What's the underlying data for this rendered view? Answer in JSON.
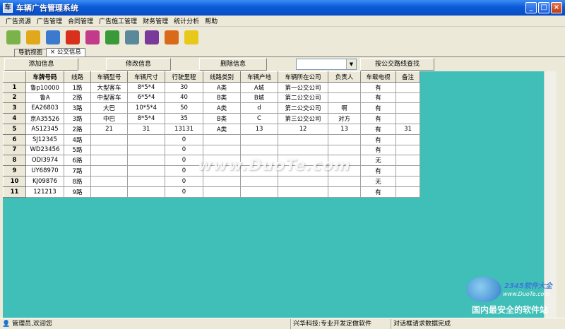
{
  "window": {
    "title": "车辆广告管理系统",
    "icon": "app-icon"
  },
  "menu": [
    "广告资源",
    "广告管理",
    "合同管理",
    "广告施工管理",
    "财务管理",
    "统计分析",
    "帮助"
  ],
  "toolbar": [
    {
      "icon": "people-icon",
      "color": "#7ab34a"
    },
    {
      "icon": "documents-icon",
      "color": "#e0a81a"
    },
    {
      "icon": "forms-icon",
      "color": "#3c7ad0"
    },
    {
      "icon": "umbrella-icon",
      "color": "#d8301c"
    },
    {
      "icon": "alarm-clock-icon",
      "color": "#c43a8a"
    },
    {
      "icon": "picture-icon",
      "color": "#3a9a3a"
    },
    {
      "icon": "pda-icon",
      "color": "#5a8a9a"
    },
    {
      "icon": "help-book-icon",
      "color": "#7a3a9a"
    },
    {
      "icon": "gift-icon",
      "color": "#d86a1a"
    },
    {
      "icon": "running-man-icon",
      "color": "#e8c81a"
    }
  ],
  "tabs": [
    {
      "label": "导航视图",
      "active": false
    },
    {
      "label": "× 公交信息",
      "active": true
    }
  ],
  "actions": {
    "add": "添加信息",
    "edit": "修改信息",
    "delete": "删除信息",
    "query": "按公交路线查找",
    "combo_value": ""
  },
  "table": {
    "columns": [
      "车牌号码",
      "线路",
      "车辆型号",
      "车辆尺寸",
      "行驶里程",
      "线路类别",
      "车辆产地",
      "车辆所在公司",
      "负责人",
      "车载电视",
      "备注"
    ],
    "rows": [
      [
        "1",
        "鲁p10000",
        "1路",
        "大型客车",
        "8*5*4",
        "30",
        "A类",
        "A城",
        "第一公交公司",
        "",
        "有",
        ""
      ],
      [
        "2",
        "鲁A",
        "2路",
        "中型客车",
        "6*5*4",
        "40",
        "B类",
        "B城",
        "第二公交公司",
        "",
        "有",
        ""
      ],
      [
        "3",
        "EA26803",
        "3路",
        "大巴",
        "10*5*4",
        "50",
        "A类",
        "d",
        "第二公交公司",
        "啊",
        "有",
        ""
      ],
      [
        "4",
        "京A35526",
        "3路",
        "中巴",
        "8*5*4",
        "35",
        "B类",
        "C",
        "第三公交公司",
        "对方",
        "有",
        ""
      ],
      [
        "5",
        "AS12345",
        "2路",
        "21",
        "31",
        "13131",
        "A类",
        "13",
        "12",
        "13",
        "有",
        "31"
      ],
      [
        "6",
        "SJ12345",
        "4路",
        "",
        "",
        "0",
        "",
        "",
        "",
        "",
        "有",
        ""
      ],
      [
        "7",
        "WD23456",
        "5路",
        "",
        "",
        "0",
        "",
        "",
        "",
        "",
        "有",
        ""
      ],
      [
        "8",
        "ODI3974",
        "6路",
        "",
        "",
        "0",
        "",
        "",
        "",
        "",
        "无",
        ""
      ],
      [
        "9",
        "UY68970",
        "7路",
        "",
        "",
        "0",
        "",
        "",
        "",
        "",
        "有",
        ""
      ],
      [
        "10",
        "KJ09876",
        "8路",
        "",
        "",
        "0",
        "",
        "",
        "",
        "",
        "无",
        ""
      ],
      [
        "11",
        "121213",
        "9路",
        "",
        "",
        "0",
        "",
        "",
        "",
        "",
        "有",
        ""
      ]
    ]
  },
  "watermarks": {
    "main": "www.DuoTe.com",
    "site": "www.DuoTe.com",
    "brand": "2345软件大全",
    "slogan": "国内最安全的软件站"
  },
  "status": {
    "user": "管理员,欢迎您",
    "company": "兴华科技:专业开发定做软件",
    "message": "对话框请求数据完成"
  }
}
